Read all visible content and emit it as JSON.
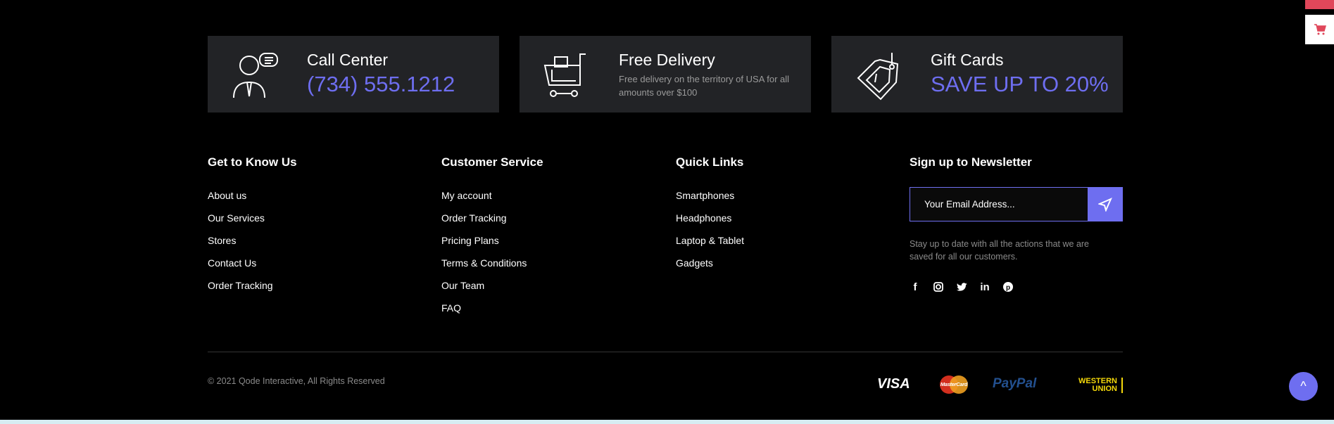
{
  "features": [
    {
      "title": "Call Center",
      "highlight": "(734) 555.1212",
      "icon": "call-center-icon"
    },
    {
      "title": "Free Delivery",
      "description": "Free delivery on the territory of USA for all amounts over $100",
      "icon": "shopping-cart-icon"
    },
    {
      "title": "Gift Cards",
      "highlight": "SAVE UP TO 20%",
      "icon": "gift-tag-icon"
    }
  ],
  "columns": [
    {
      "heading": "Get to Know Us",
      "links": [
        "About us",
        "Our Services",
        "Stores",
        "Contact Us",
        "Order Tracking"
      ]
    },
    {
      "heading": "Customer Service",
      "links": [
        "My account",
        "Order Tracking",
        "Pricing Plans",
        "Terms & Conditions",
        "Our Team",
        "FAQ"
      ]
    },
    {
      "heading": "Quick Links",
      "links": [
        "Smartphones",
        "Headphones",
        "Laptop & Tablet",
        "Gadgets"
      ]
    }
  ],
  "newsletter": {
    "heading": "Sign up to Newsletter",
    "placeholder": "Your Email Address...",
    "text": "Stay up to date with all the actions that we are saved for all our customers.",
    "social": [
      "facebook",
      "instagram",
      "twitter",
      "linkedin",
      "pinterest"
    ]
  },
  "bottom": {
    "copyright": "© 2021 Qode Interactive, All Rights Reserved",
    "payments": [
      "VISA",
      "MasterCard",
      "PayPal",
      "WESTERN UNION"
    ]
  },
  "colors": {
    "accent": "#6e6ef0",
    "panel": "#222326",
    "cart": "#e0475a"
  }
}
